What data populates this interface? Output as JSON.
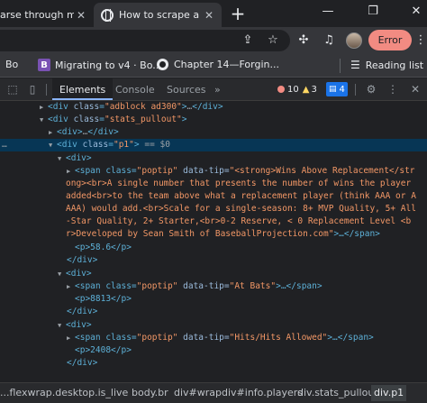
{
  "tabs": [
    {
      "title": "arse through mul"
    },
    {
      "title": "How to scrape a w"
    }
  ],
  "toolbar": {
    "error_label": "Error"
  },
  "bookmarks": [
    {
      "label": "Bo"
    },
    {
      "label": "Migrating to v4 · Bo..."
    },
    {
      "label": "Chapter 14—Forgin..."
    },
    {
      "label": "Reading list"
    }
  ],
  "devtools": {
    "tabs": [
      "Elements",
      "Console",
      "Sources"
    ],
    "more": "»",
    "errors": "10",
    "warnings": "3",
    "info": "4"
  },
  "tree": {
    "l1_tag": "div",
    "l1_attr": "class",
    "l1_val": "\"adblock ad300\"",
    "l1_ell": "…",
    "l1_close": "</div>",
    "l2_tag": "div",
    "l2_attr": "class",
    "l2_val": "\"stats_pullout\"",
    "l3_open": "<div>",
    "l3_ell": "…",
    "l3_close": "</div>",
    "sel_dots": "…",
    "sel_tag": "div",
    "sel_attr": "class",
    "sel_val": "\"p1\"",
    "sel_eq": "== $0",
    "l5": "<div>",
    "span1_pre": "<span class=",
    "span1_cls": "\"poptip\"",
    "span1_attr": " data-tip=",
    "span1_l1": "\"<strong>Wins Above Replacement</str",
    "span1_l2": "ong><br>A single number that presents the number of wins the player",
    "span1_l3": "added<br>to the team above what a replacement player (think AAA or A",
    "span1_l4": "AAA) would add.<br>Scale for a single-season: 8+ MVP Quality, 5+ All",
    "span1_l5": "-Star Quality, 2+ Starter,<br>0-2 Reserve, < 0 Replacement Level  <b",
    "span1_l6": "r>Developed by Sean Smith of BaseballProjection.com\"",
    "span1_ell": ">…</span>",
    "p1": "<p>58.6</p>",
    "div_close": "</div>",
    "div2_open": "<div>",
    "span2_val": "\"At Bats\"",
    "span2_ell": ">…</span>",
    "p2": "<p>8813</p>",
    "div2_close": "</div>",
    "div3_open": "<div>",
    "span3_val": "\"Hits/Hits Allowed\"",
    "span3_ell": ">…</span>",
    "p3": "<p>2408</p>",
    "div3_close": "</div>"
  },
  "breadcrumbs": [
    "...flexwrap.desktop.is_live",
    "body.br",
    "div#wrap",
    "div#info.players",
    "div.stats_pullout",
    "div.p1"
  ]
}
